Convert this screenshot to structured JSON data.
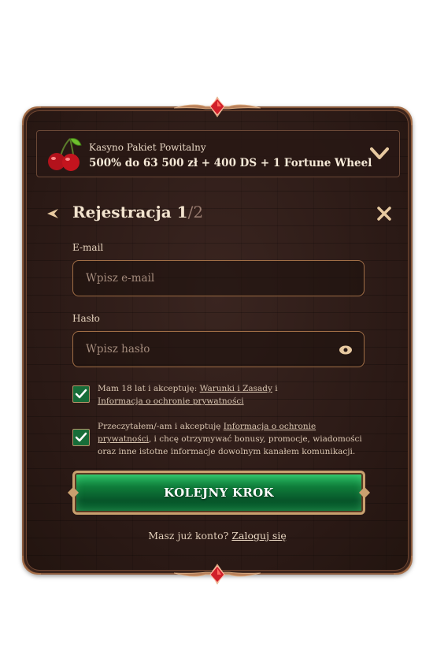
{
  "bonus": {
    "title": "Kasyno Pakiet Powitalny",
    "offer": "500% do 63 500 zł + 400 DS + 1 Fortune Wheel"
  },
  "registration": {
    "title": "Rejestracja",
    "step_current": "1",
    "step_separator": "/",
    "step_total": "2"
  },
  "email": {
    "label": "E-mail",
    "placeholder": "Wpisz e-mail",
    "value": ""
  },
  "password": {
    "label": "Hasło",
    "placeholder": "Wpisz hasło",
    "value": ""
  },
  "consent_terms": {
    "checked": true,
    "text_before": "Mam 18 lat i akceptuję: ",
    "terms_link": "Warunki i Zasady",
    "text_between": " i",
    "privacy_link": "Informacja o ochronie prywatności"
  },
  "consent_marketing": {
    "checked": true,
    "text_before": "Przeczytałem/-am i akceptuję ",
    "privacy_link": "Informacja o ochronie prywatności",
    "text_after": ", i chcę otrzymywać bonusy, promocje, wiadomości oraz inne istotne informacje dowolnym kanałem komunikacji."
  },
  "cta": {
    "label": "KOLEJNY KROK"
  },
  "login": {
    "prompt": "Masz już konto?",
    "link": "Zaloguj się"
  },
  "colors": {
    "panel_bg": "#2e1c18",
    "border_gold": "#a06e46",
    "cta_green": "#0f7d3a",
    "text_light": "#f3e4cf",
    "gem_red": "#d0202a"
  }
}
